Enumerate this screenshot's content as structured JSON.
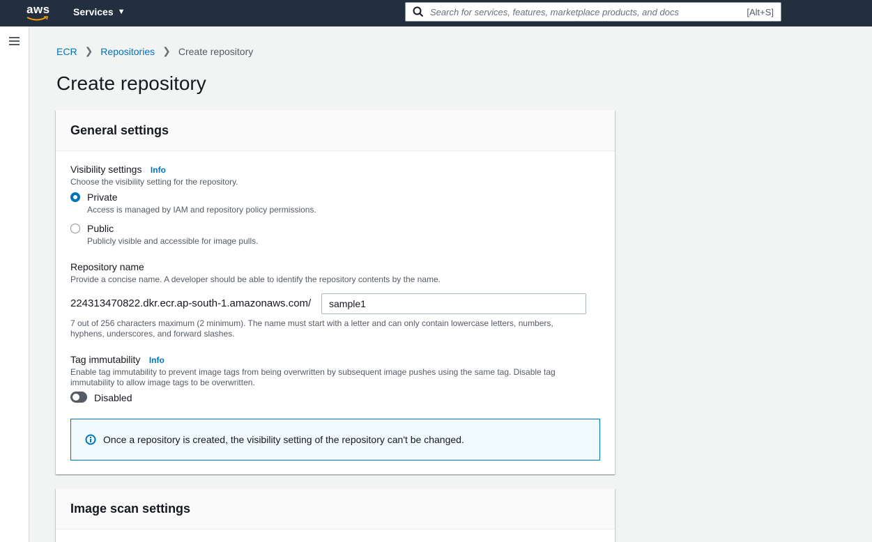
{
  "topnav": {
    "logo_text": "aws",
    "services_label": "Services",
    "search_placeholder": "Search for services, features, marketplace products, and docs",
    "search_shortcut": "[Alt+S]"
  },
  "breadcrumb": {
    "items": [
      "ECR",
      "Repositories",
      "Create repository"
    ]
  },
  "page_title": "Create repository",
  "general_settings": {
    "title": "General settings",
    "visibility": {
      "label": "Visibility settings",
      "info": "Info",
      "description": "Choose the visibility setting for the repository.",
      "options": [
        {
          "label": "Private",
          "description": "Access is managed by IAM and repository policy permissions.",
          "selected": true
        },
        {
          "label": "Public",
          "description": "Publicly visible and accessible for image pulls.",
          "selected": false
        }
      ]
    },
    "repository_name": {
      "label": "Repository name",
      "description": "Provide a concise name. A developer should be able to identify the repository contents by the name.",
      "prefix": "224313470822.dkr.ecr.ap-south-1.amazonaws.com/",
      "value": "sample1",
      "constraint_line1": "7 out of 256 characters maximum (2 minimum). The name must start with a letter and can only contain lowercase letters, numbers,",
      "constraint_line2": "hyphens, underscores, and forward slashes."
    },
    "tag_immutability": {
      "label": "Tag immutability",
      "info": "Info",
      "description_line1": "Enable tag immutability to prevent image tags from being overwritten by subsequent image pushes using the same tag. Disable tag",
      "description_line2": "immutability to allow image tags to be overwritten.",
      "toggle_label": "Disabled"
    },
    "alert": "Once a repository is created, the visibility setting of the repository can't be changed."
  },
  "image_scan_settings": {
    "title": "Image scan settings"
  },
  "colors": {
    "nav_bg": "#232f3e",
    "link": "#0073bb",
    "accent": "#0073bb"
  }
}
